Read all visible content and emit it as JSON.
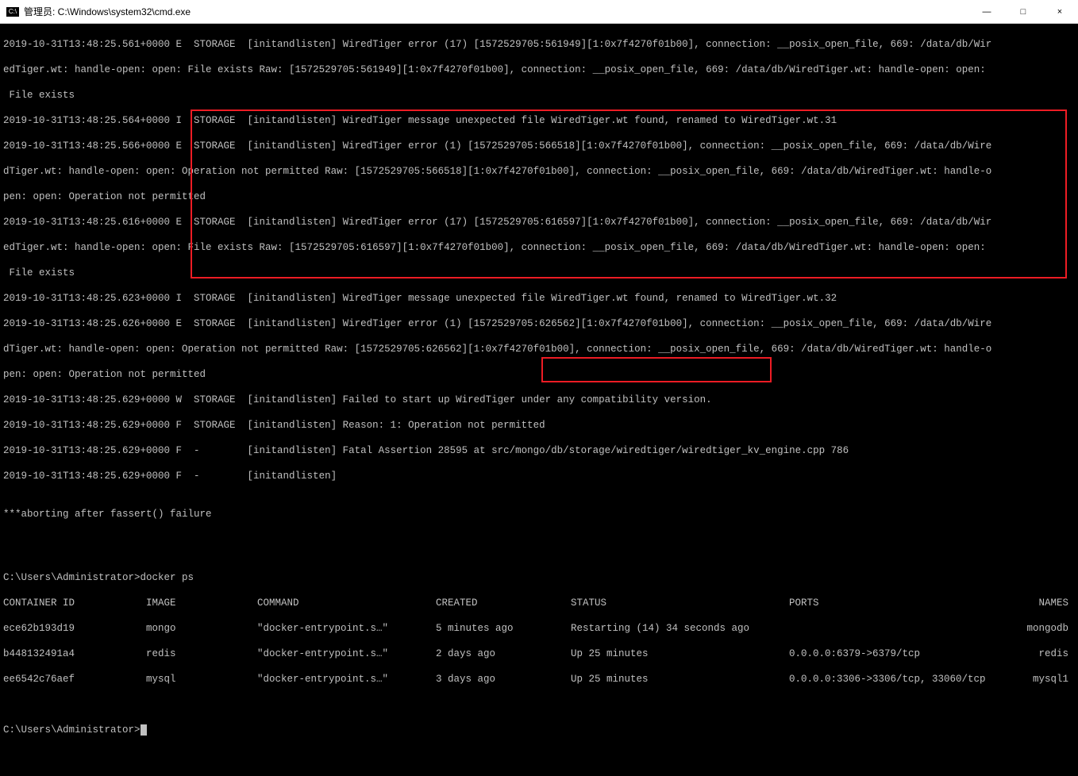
{
  "titlebar": {
    "icon_label": "C:\\",
    "title": "管理员: C:\\Windows\\system32\\cmd.exe",
    "minimize": "—",
    "maximize": "□",
    "close": "×"
  },
  "log_lines": [
    "2019-10-31T13:48:25.561+0000 E  STORAGE  [initandlisten] WiredTiger error (17) [1572529705:561949][1:0x7f4270f01b00], connection: __posix_open_file, 669: /data/db/Wir",
    "edTiger.wt: handle-open: open: File exists Raw: [1572529705:561949][1:0x7f4270f01b00], connection: __posix_open_file, 669: /data/db/WiredTiger.wt: handle-open: open:",
    " File exists",
    "2019-10-31T13:48:25.564+0000 I  STORAGE  [initandlisten] WiredTiger message unexpected file WiredTiger.wt found, renamed to WiredTiger.wt.31",
    "2019-10-31T13:48:25.566+0000 E  STORAGE  [initandlisten] WiredTiger error (1) [1572529705:566518][1:0x7f4270f01b00], connection: __posix_open_file, 669: /data/db/Wire",
    "dTiger.wt: handle-open: open: Operation not permitted Raw: [1572529705:566518][1:0x7f4270f01b00], connection: __posix_open_file, 669: /data/db/WiredTiger.wt: handle-o",
    "pen: open: Operation not permitted",
    "2019-10-31T13:48:25.616+0000 E  STORAGE  [initandlisten] WiredTiger error (17) [1572529705:616597][1:0x7f4270f01b00], connection: __posix_open_file, 669: /data/db/Wir",
    "edTiger.wt: handle-open: open: File exists Raw: [1572529705:616597][1:0x7f4270f01b00], connection: __posix_open_file, 669: /data/db/WiredTiger.wt: handle-open: open:",
    " File exists",
    "2019-10-31T13:48:25.623+0000 I  STORAGE  [initandlisten] WiredTiger message unexpected file WiredTiger.wt found, renamed to WiredTiger.wt.32",
    "2019-10-31T13:48:25.626+0000 E  STORAGE  [initandlisten] WiredTiger error (1) [1572529705:626562][1:0x7f4270f01b00], connection: __posix_open_file, 669: /data/db/Wire",
    "dTiger.wt: handle-open: open: Operation not permitted Raw: [1572529705:626562][1:0x7f4270f01b00], connection: __posix_open_file, 669: /data/db/WiredTiger.wt: handle-o",
    "pen: open: Operation not permitted",
    "2019-10-31T13:48:25.629+0000 W  STORAGE  [initandlisten] Failed to start up WiredTiger under any compatibility version.",
    "2019-10-31T13:48:25.629+0000 F  STORAGE  [initandlisten] Reason: 1: Operation not permitted",
    "2019-10-31T13:48:25.629+0000 F  -        [initandlisten] Fatal Assertion 28595 at src/mongo/db/storage/wiredtiger/wiredtiger_kv_engine.cpp 786",
    "2019-10-31T13:48:25.629+0000 F  -        [initandlisten] ",
    "",
    "***aborting after fassert() failure",
    "",
    "",
    ""
  ],
  "prompt1": "C:\\Users\\Administrator>",
  "command1": "docker ps",
  "table": {
    "headers": {
      "id": "CONTAINER ID",
      "image": "IMAGE",
      "command": "COMMAND",
      "created": "CREATED",
      "status": "STATUS",
      "ports": "PORTS",
      "names": "NAMES"
    },
    "rows": [
      {
        "id": "ece62b193d19",
        "image": "mongo",
        "command": "\"docker-entrypoint.s…\"",
        "created": "5 minutes ago",
        "status": "Restarting (14) 34 seconds ago",
        "ports": "",
        "names": "mongodb"
      },
      {
        "id": "b448132491a4",
        "image": "redis",
        "command": "\"docker-entrypoint.s…\"",
        "created": "2 days ago",
        "status": "Up 25 minutes",
        "ports": "0.0.0.0:6379->6379/tcp",
        "names": "redis"
      },
      {
        "id": "ee6542c76aef",
        "image": "mysql",
        "command": "\"docker-entrypoint.s…\"",
        "created": "3 days ago",
        "status": "Up 25 minutes",
        "ports": "0.0.0.0:3306->3306/tcp, 33060/tcp",
        "names": "mysql1"
      }
    ]
  },
  "prompt2": "C:\\Users\\Administrator>"
}
